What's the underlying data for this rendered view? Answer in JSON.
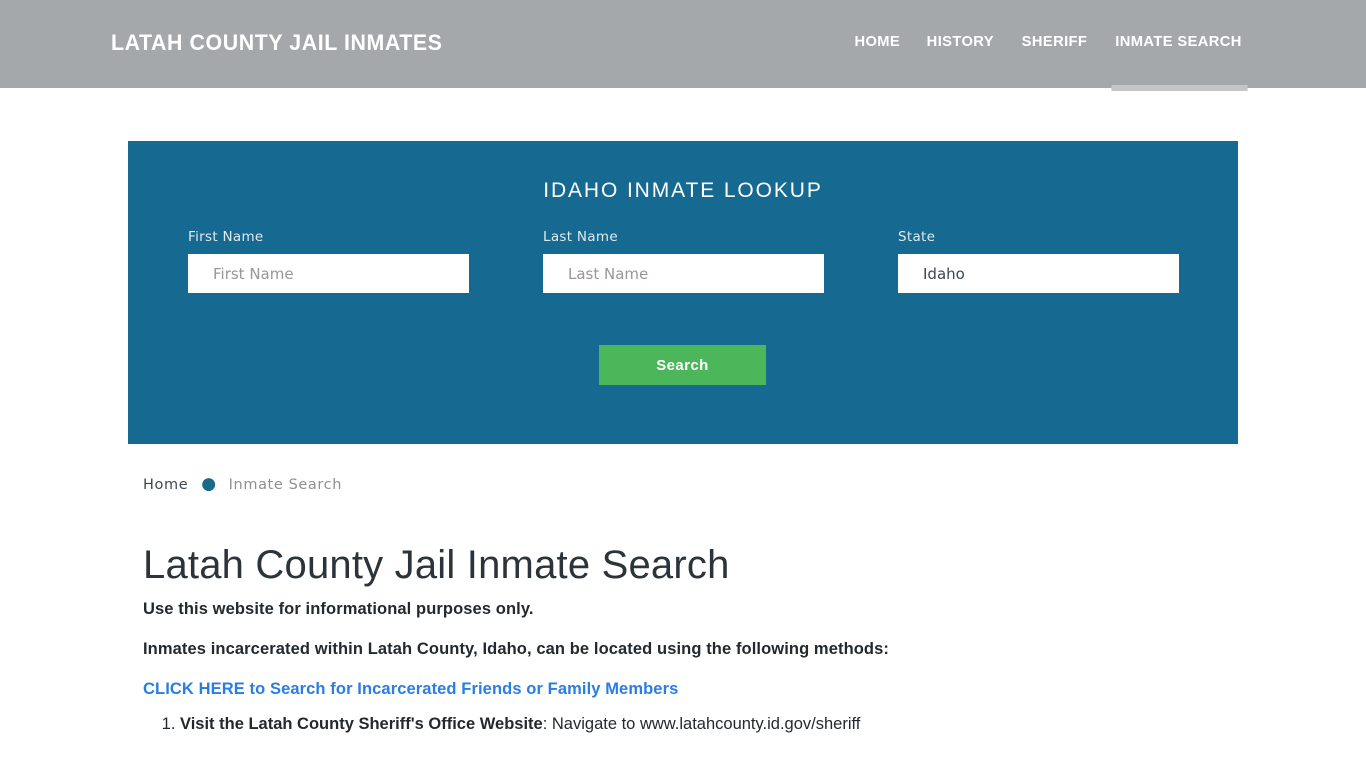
{
  "header": {
    "brand": "LATAH COUNTY JAIL INMATES",
    "background_color": "#a4a8ab",
    "nav": [
      {
        "label": "HOME",
        "active": false
      },
      {
        "label": "HISTORY",
        "active": false
      },
      {
        "label": "SHERIFF",
        "active": false
      },
      {
        "label": "INMATE SEARCH",
        "active": true
      }
    ]
  },
  "search_panel": {
    "title": "IDAHO INMATE LOOKUP",
    "background_color": "#166a91",
    "fields": {
      "first_name": {
        "label": "First Name",
        "placeholder": "First Name",
        "value": ""
      },
      "last_name": {
        "label": "Last Name",
        "placeholder": "Last Name",
        "value": ""
      },
      "state": {
        "label": "State",
        "placeholder": "Idaho",
        "value": "Idaho"
      }
    },
    "submit": {
      "label": "Search",
      "color": "#4cb65a"
    }
  },
  "breadcrumb": {
    "home": "Home",
    "separator": "●",
    "current": "Inmate Search",
    "dot_color": "#1a6a8a"
  },
  "main": {
    "heading": "Latah County Jail Inmate Search",
    "paragraph_1": "Use this website for informational purposes only.",
    "paragraph_2": "Inmates incarcerated within Latah County, Idaho, can be located using the following methods:",
    "link": {
      "text": "CLICK HERE to Search for Incarcerated Friends or Family Members",
      "color": "#2a7de1"
    },
    "methods": [
      {
        "bold": "Visit the Latah County Sheriff's Office Website",
        "rest": ": Navigate to www.latahcounty.id.gov/sheriff"
      }
    ]
  }
}
